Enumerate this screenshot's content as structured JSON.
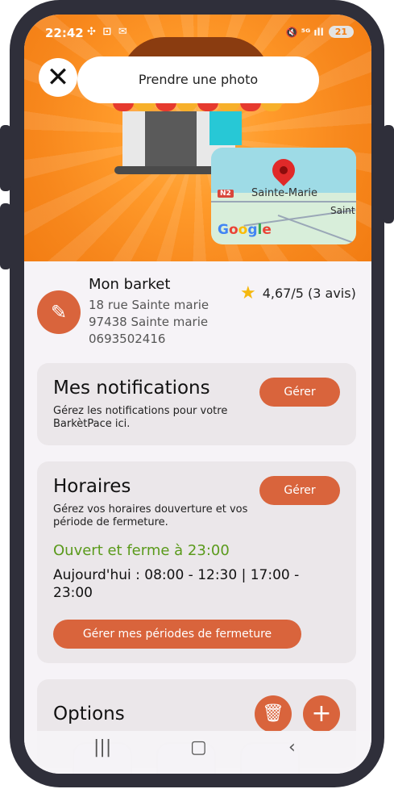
{
  "status_bar": {
    "time": "22:42",
    "left_icons": "✣ ⊡ ✉",
    "right_icons": "🔇 ⁵ᴳ ıll",
    "battery": "21"
  },
  "header": {
    "action_label": "Prendre une photo",
    "close_icon": "close-icon"
  },
  "map": {
    "road_badge": "N2",
    "city": "Sainte-Marie",
    "nearby": "Saint",
    "brand": "Google"
  },
  "shop": {
    "name": "Mon barket",
    "address_line1": "18 rue Sainte marie",
    "address_line2": "97438 Sainte marie",
    "phone": "0693502416",
    "rating": "4,67/5 (3 avis)"
  },
  "notifications": {
    "title": "Mes notifications",
    "description": "Gérez les notifications pour votre BarkètPace ici.",
    "button": "Gérer"
  },
  "hours": {
    "title": "Horaires",
    "description": "Gérez vos horaires douverture et vos période de fermeture.",
    "button": "Gérer",
    "status": "Ouvert et ferme à 23:00",
    "today": "Aujourd'hui : 08:00 - 12:30  | 17:00 - 23:00",
    "periods_button": "Gérer mes périodes de fermeture"
  },
  "options": {
    "title": "Options"
  },
  "colors": {
    "accent": "#d9643c",
    "hero": "#f7871c",
    "open": "#5a9a1b"
  }
}
